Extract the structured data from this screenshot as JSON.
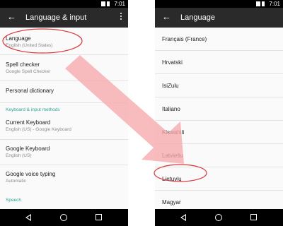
{
  "status": {
    "time": "7:01"
  },
  "left": {
    "title": "Language & input",
    "items": [
      {
        "primary": "Language",
        "secondary": "English (United States)"
      },
      {
        "primary": "Spell checker",
        "secondary": "Google Spell Checker"
      },
      {
        "primary": "Personal dictionary",
        "secondary": ""
      },
      {
        "primary": "Current Keyboard",
        "secondary": "English (US) - Google Keyboard"
      },
      {
        "primary": "Google Keyboard",
        "secondary": "English (US)"
      },
      {
        "primary": "Google voice typing",
        "secondary": "Automatic"
      }
    ],
    "sections": [
      "Keyboard & input methods",
      "Speech"
    ]
  },
  "right": {
    "title": "Language",
    "languages": [
      "Français (France)",
      "Hrvatski",
      "IsiZulu",
      "Italiano",
      "Kiswahili",
      "Latviešu",
      "Lietuvių",
      "Magyar"
    ]
  },
  "colors": {
    "appbar": "#2a2a2a",
    "accent": "#2aa59a",
    "highlight": "#d9383a",
    "arrow": "#f6a9ad"
  },
  "icons": {
    "back": "back-arrow-icon",
    "overflow": "more-vert-icon",
    "nav_back": "nav-back-icon",
    "nav_home": "nav-home-icon",
    "nav_recent": "nav-recents-icon"
  }
}
